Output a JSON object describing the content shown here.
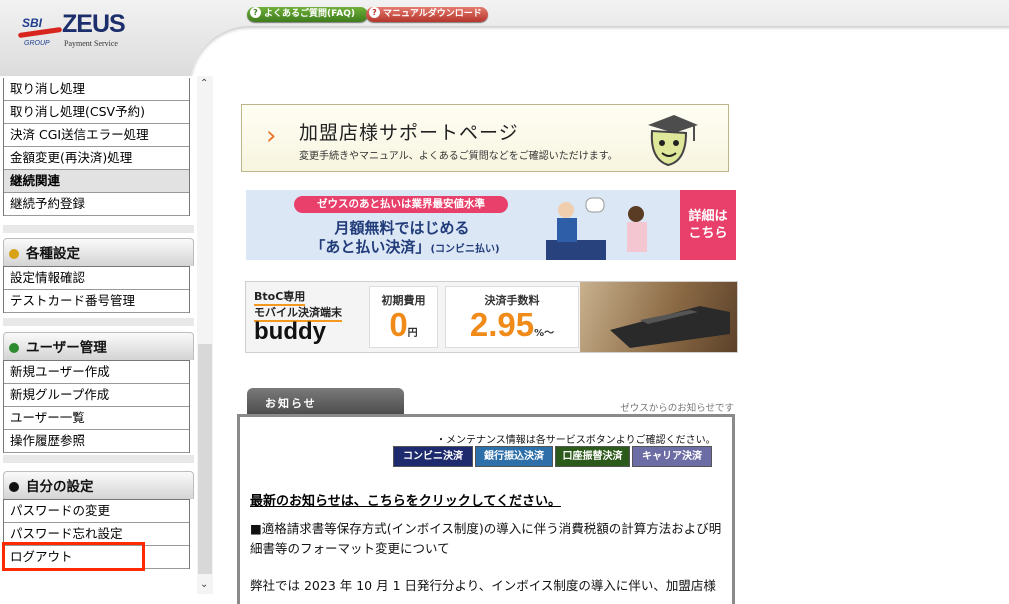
{
  "header": {
    "logo": {
      "sbi": "SBI",
      "zeus": "ZEUS",
      "group": "GROUP",
      "payment_service": "Payment Service"
    },
    "faq_label": "よくあるご質問(FAQ)",
    "manual_label": "マニュアルダウンロード"
  },
  "sidebar": {
    "top_items": [
      "取り消し処理",
      "取り消し処理(CSV予約)",
      "決済 CGI送信エラー処理",
      "金額変更(再決済)処理"
    ],
    "continuous": {
      "label": "継続関連",
      "items": [
        "継続予約登録"
      ]
    },
    "settings": {
      "title": "各種設定",
      "color": "#d8a217",
      "items": [
        "設定情報確認",
        "テストカード番号管理"
      ]
    },
    "users": {
      "title": "ユーザー管理",
      "color": "#2e8b2e",
      "items": [
        "新規ユーザー作成",
        "新規グループ作成",
        "ユーザー一覧",
        "操作履歴参照"
      ]
    },
    "my_settings": {
      "title": "自分の設定",
      "color": "#111111",
      "items": [
        "パスワードの変更",
        "パスワード忘れ設定",
        "ログアウト"
      ]
    }
  },
  "banners": {
    "support": {
      "title": "加盟店様サポートページ",
      "subtitle": "変更手続きやマニュアル、よくあるご質問などをご確認いただけます。"
    },
    "atobarai": {
      "pill": "ゼウスのあと払いは業界最安値水準",
      "line1": "月額無料ではじめる",
      "line2": "「あと払い決済」",
      "line2_small": "(コンビニ払い)",
      "cta_1": "詳細は",
      "cta_2": "こちら"
    },
    "buddy": {
      "line1": "BtoC専用",
      "line2": "モバイル決済端末",
      "line3": "buddy",
      "initial_caption": "初期費用",
      "initial_value": "0",
      "initial_unit": "円",
      "fee_caption": "決済手数料",
      "fee_value": "2.95",
      "fee_unit": "%～"
    }
  },
  "notice": {
    "tab": "お知らせ",
    "caption": "ゼウスからのお知らせです",
    "maintenance": "・メンテナンス情報は各サービスボタンよりご確認ください。",
    "services": [
      "コンビニ決済",
      "銀行振込決済",
      "口座振替決済",
      "キャリア決済"
    ],
    "latest_link": "最新のお知らせは、こちらをクリックしてください。",
    "p1": "■適格請求書等保存方式(インボイス制度)の導入に伴う消費税額の計算方法および明細書等のフォーマット変更について",
    "p2": "弊社では 2023 年 10 月 1 日発行分より、インボイス制度の導入に伴い、加盟店様"
  }
}
